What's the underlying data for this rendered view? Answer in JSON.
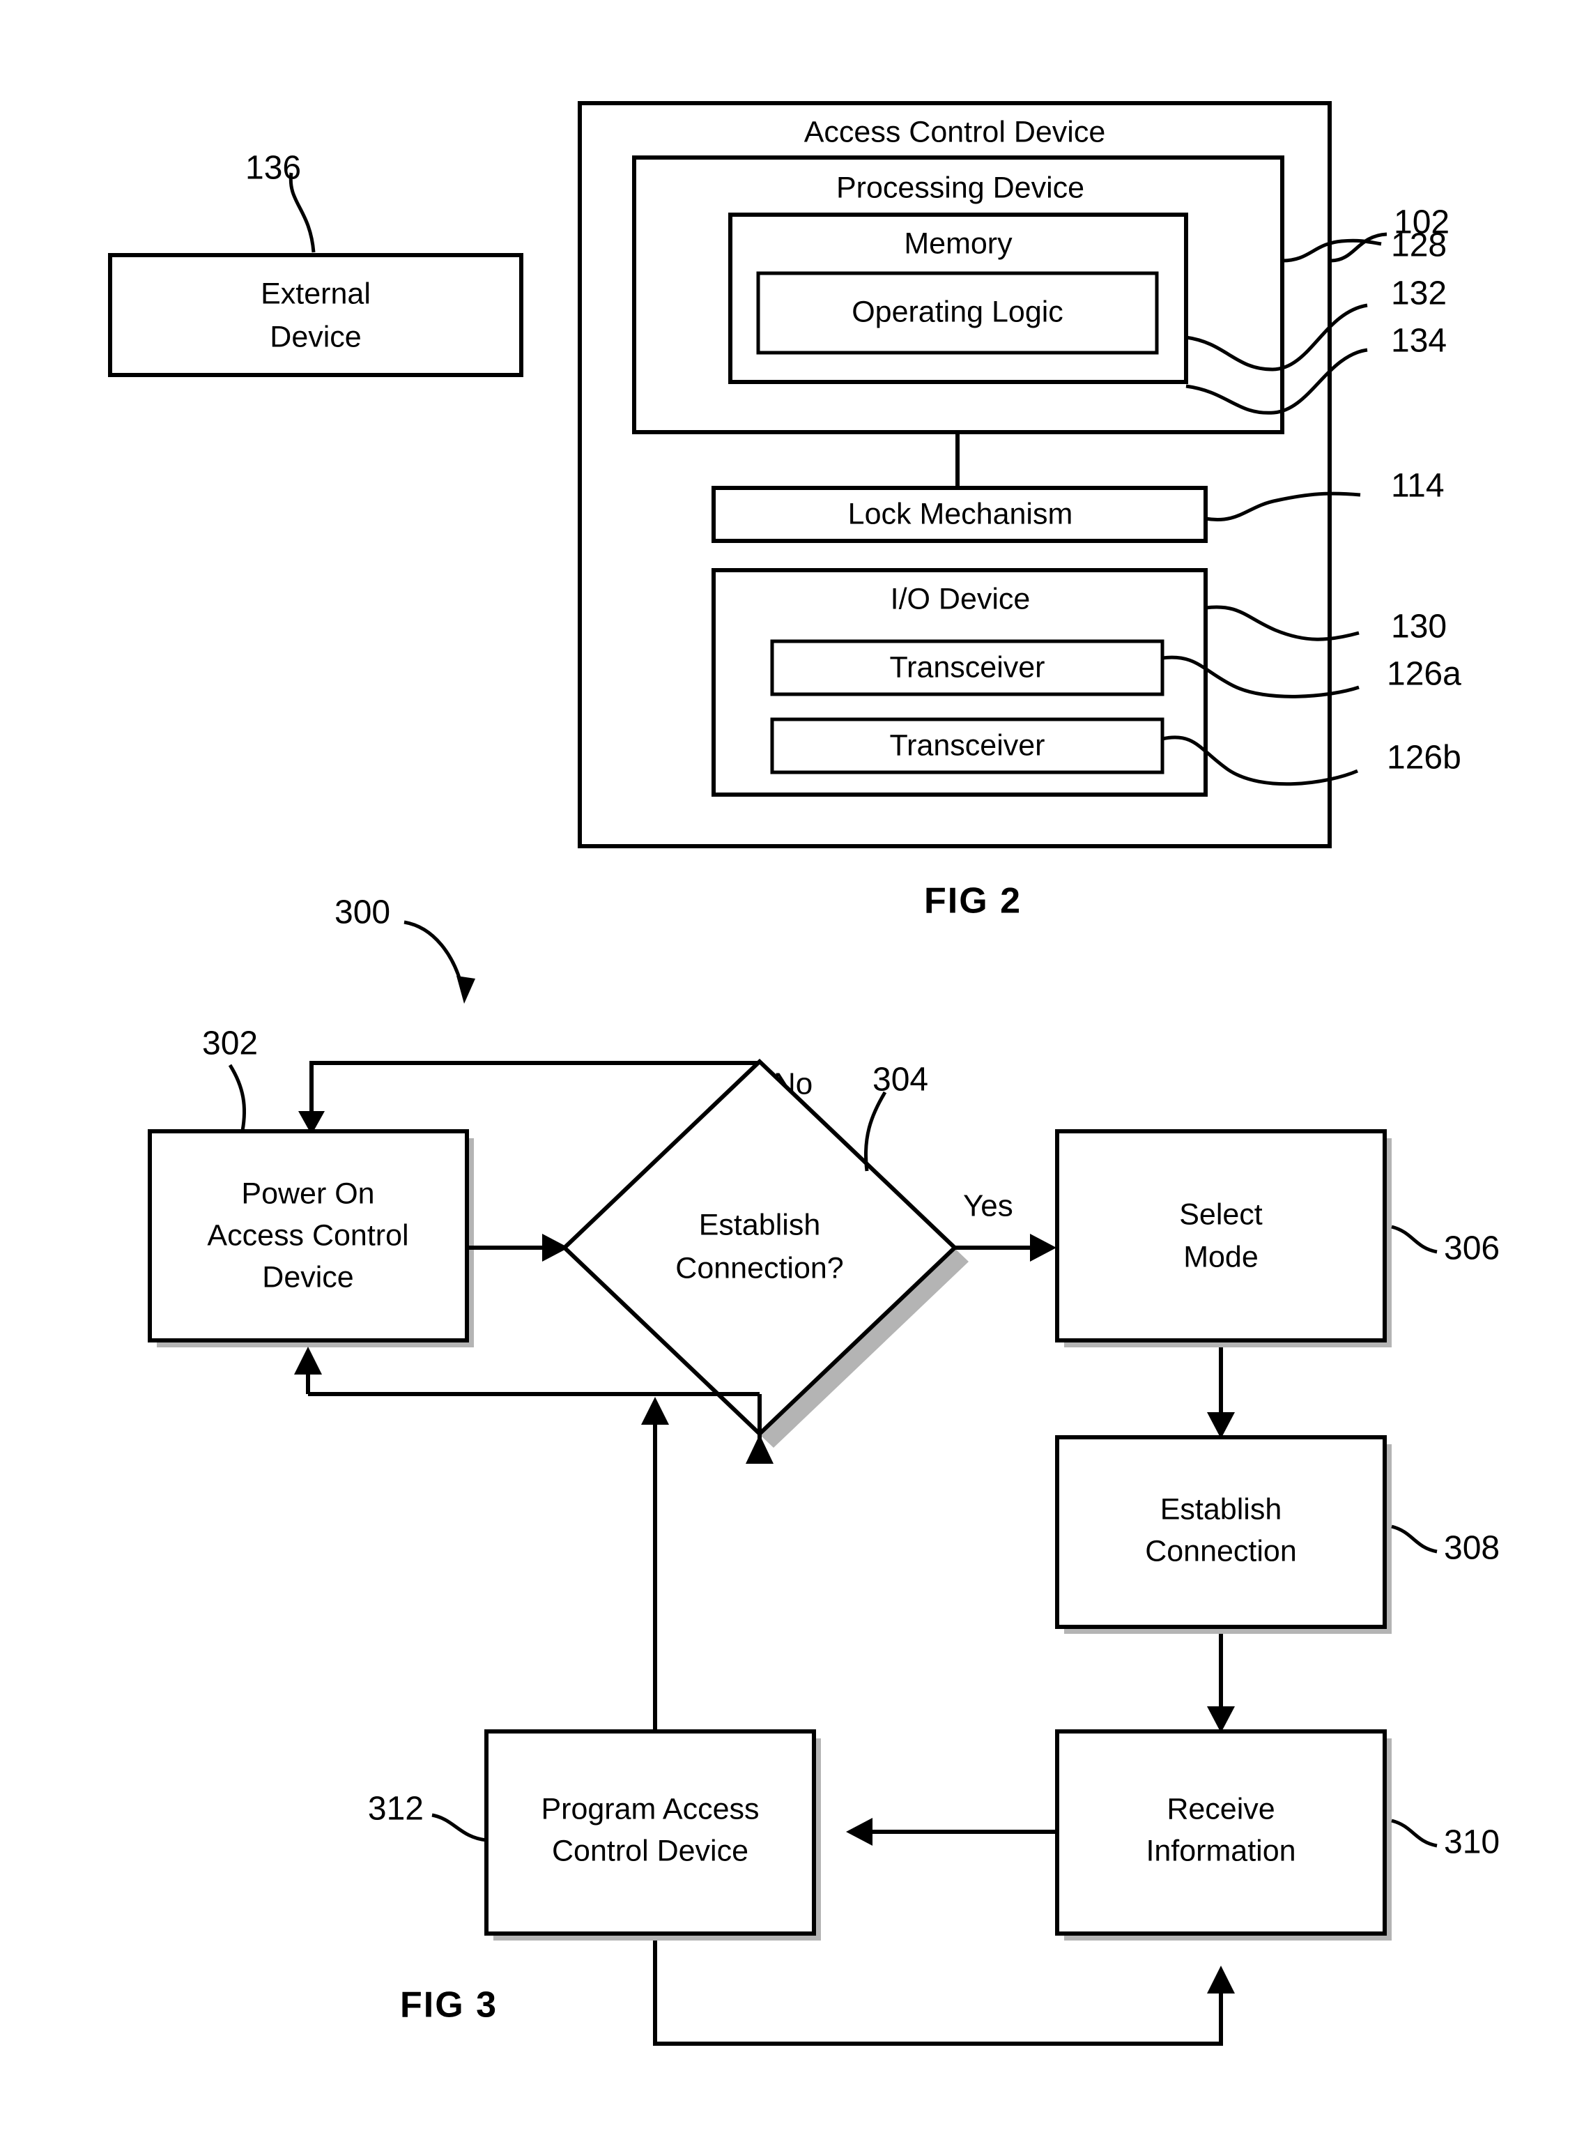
{
  "figures": [
    {
      "caption": "FIG  2",
      "id": "fig2",
      "external_device": {
        "label_line1": "External",
        "label_line2": "Device",
        "ref": "136"
      },
      "blocks": [
        {
          "key": "access_control_device",
          "label": "Access Control Device",
          "ref": "102"
        },
        {
          "key": "processing_device",
          "label": "Processing Device",
          "ref": "128"
        },
        {
          "key": "memory",
          "label": "Memory",
          "ref": "132"
        },
        {
          "key": "operating_logic",
          "label": "Operating Logic",
          "ref": "134"
        },
        {
          "key": "lock_mechanism",
          "label": "Lock Mechanism",
          "ref": "114"
        },
        {
          "key": "io_device",
          "label": "I/O Device",
          "ref": "130"
        },
        {
          "key": "transceiver_a",
          "label": "Transceiver",
          "ref": "126a"
        },
        {
          "key": "transceiver_b",
          "label": "Transceiver",
          "ref": "126b"
        }
      ]
    },
    {
      "caption": "FIG  3",
      "id": "fig3",
      "flow_ref": "300",
      "branch_labels": {
        "no": "No",
        "yes": "Yes"
      },
      "steps": [
        {
          "key": "power_on",
          "ref": "302",
          "lines": [
            "Power On",
            "Access Control",
            "Device"
          ],
          "shape": "process"
        },
        {
          "key": "establish_connection_q",
          "ref": "304",
          "lines": [
            "Establish",
            "Connection?"
          ],
          "shape": "decision"
        },
        {
          "key": "select_mode",
          "ref": "306",
          "lines": [
            "Select",
            "Mode"
          ],
          "shape": "process"
        },
        {
          "key": "establish_connection",
          "ref": "308",
          "lines": [
            "Establish",
            "Connection"
          ],
          "shape": "process"
        },
        {
          "key": "receive_information",
          "ref": "310",
          "lines": [
            "Receive",
            "Information"
          ],
          "shape": "process"
        },
        {
          "key": "program_access_control_device",
          "ref": "312",
          "lines": [
            "Program Access",
            "Control Device"
          ],
          "shape": "process"
        }
      ]
    }
  ],
  "colors": {
    "line": "#000000",
    "fill": "#ffffff",
    "shadow": "#b4b4b4"
  }
}
